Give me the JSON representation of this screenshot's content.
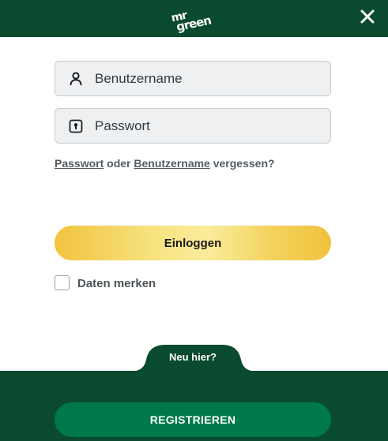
{
  "header": {
    "logo_line1": "mr",
    "logo_line2": "green",
    "close_icon": "close-icon"
  },
  "form": {
    "username": {
      "placeholder": "Benutzername",
      "value": "",
      "icon": "user-icon"
    },
    "password": {
      "placeholder": "Passwort",
      "value": "",
      "icon": "lock-icon"
    },
    "forgot": {
      "password_link": "Passwort",
      "connector": " oder ",
      "username_link": "Benutzername",
      "suffix": " vergessen?"
    },
    "login_label": "Einloggen",
    "remember_label": "Daten merken",
    "remember_checked": false
  },
  "footer": {
    "new_here": "Neu hier?",
    "register_label": "REGISTRIEREN"
  },
  "colors": {
    "brand_green": "#0a4a2e",
    "button_green": "#00794a",
    "gold": "#f1c33f"
  }
}
